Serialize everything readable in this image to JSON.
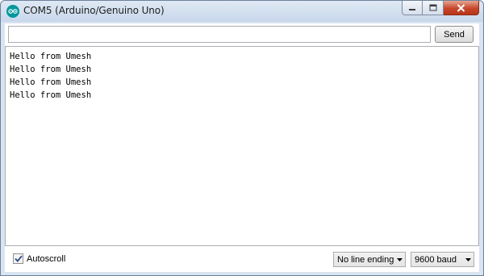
{
  "window": {
    "title": "COM5 (Arduino/Genuino Uno)",
    "icon": "arduino-logo-icon",
    "controls": [
      "minimize-icon",
      "maximize-icon",
      "close-icon"
    ]
  },
  "send": {
    "input_value": "",
    "button_label": "Send"
  },
  "output": {
    "lines": [
      "Hello from Umesh",
      "Hello from Umesh",
      "Hello from Umesh",
      "Hello from Umesh"
    ]
  },
  "footer": {
    "autoscroll_label": "Autoscroll",
    "autoscroll_checked": true,
    "line_ending": "No line ending",
    "baud_rate": "9600 baud"
  },
  "colors": {
    "accent": "#00979c",
    "close": "#c7472c"
  }
}
